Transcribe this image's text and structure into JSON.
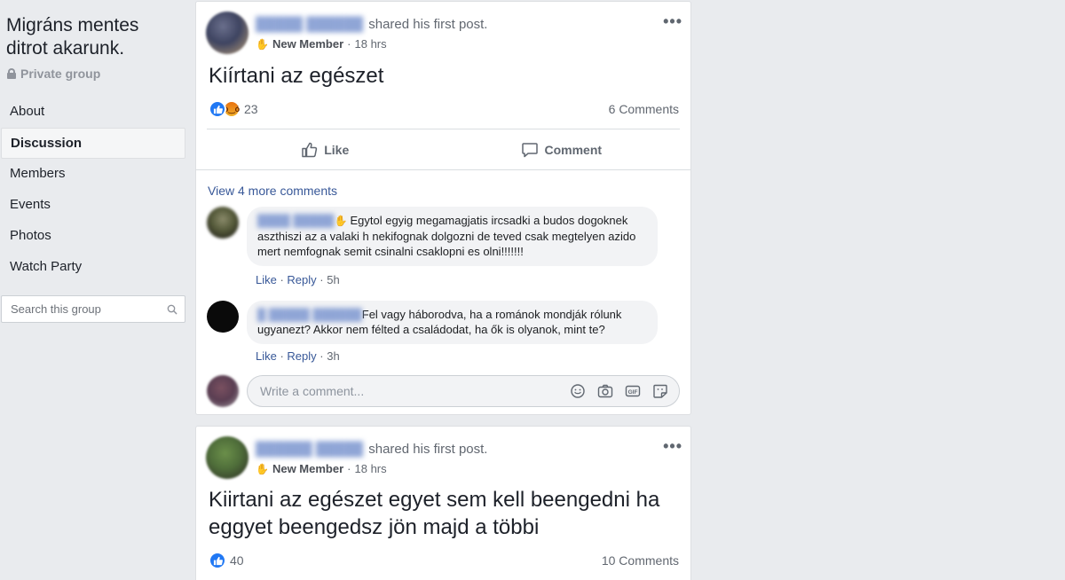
{
  "group": {
    "name": "Migráns mentes ditrot akarunk.",
    "privacy": "Private group"
  },
  "sidebar": {
    "items": [
      {
        "label": "About",
        "active": false
      },
      {
        "label": "Discussion",
        "active": true
      },
      {
        "label": "Members",
        "active": false
      },
      {
        "label": "Events",
        "active": false
      },
      {
        "label": "Photos",
        "active": false
      },
      {
        "label": "Watch Party",
        "active": false
      }
    ],
    "search_placeholder": "Search this group"
  },
  "posts": [
    {
      "author_action": "shared his first post.",
      "badge": "New Member",
      "time": "18 hrs",
      "text": "Kiírtani az egészet",
      "reactions": [
        "like-icon",
        "angry-icon"
      ],
      "reaction_count": "23",
      "comment_count": "6 Comments",
      "like_label": "Like",
      "comment_label": "Comment",
      "view_more": "View 4 more comments",
      "comments": [
        {
          "text": "Egytol egyig megamagjatis ircsadki a budos dogoknek aszthiszi az a valaki h nekifognak dolgozni de teved csak megtelyen azido mert nemfognak semit csinalni csaklopni es olni!!!!!!!",
          "like": "Like",
          "reply": "Reply",
          "time": "5h"
        },
        {
          "text": "Fel vagy háborodva, ha a románok mondják rólunk ugyanezt? Akkor nem félted a családodat, ha ők is olyanok, mint te?",
          "like": "Like",
          "reply": "Reply",
          "time": "3h"
        }
      ],
      "write_placeholder": "Write a comment..."
    },
    {
      "author_action": "shared his first post.",
      "badge": "New Member",
      "time": "18 hrs",
      "text": "Kiirtani az egészet egyet sem kell beengedni ha eggyet beengedsz jön majd a többi",
      "reactions": [
        "like-icon"
      ],
      "reaction_count": "40",
      "comment_count": "10 Comments"
    }
  ],
  "colors": {
    "background": "#e9ebee",
    "link": "#385898",
    "like_blue": "#2078f4",
    "meta_gray": "#616770"
  }
}
